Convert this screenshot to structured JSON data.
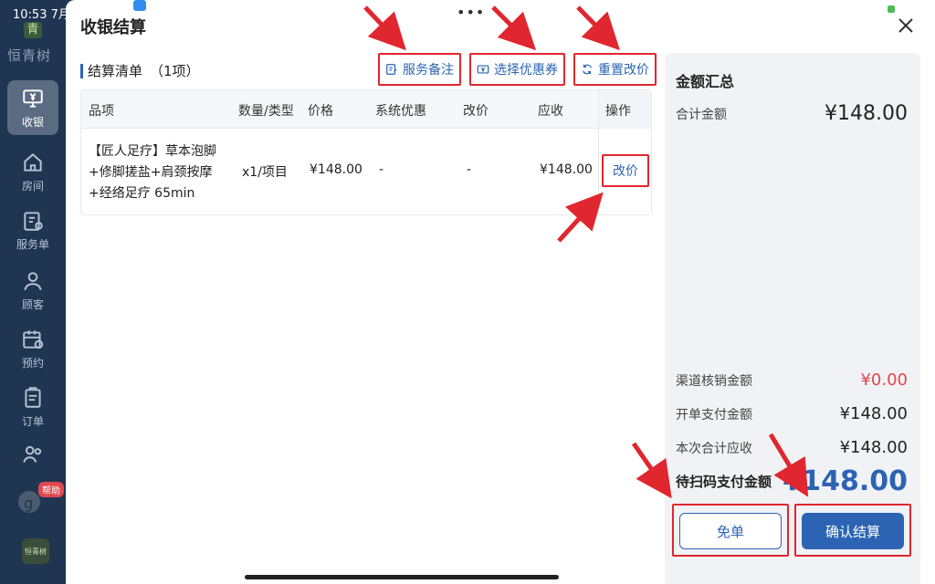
{
  "status": {
    "time": "10:53  7月"
  },
  "sidebar": {
    "logo_text": "恒青树",
    "items": [
      {
        "label": "收银",
        "icon": "cashier-icon",
        "active": true
      },
      {
        "label": "房间",
        "icon": "home-icon"
      },
      {
        "label": "服务单",
        "icon": "service-order-icon"
      },
      {
        "label": "顾客",
        "icon": "user-icon"
      },
      {
        "label": "预约",
        "icon": "calendar-icon"
      },
      {
        "label": "订单",
        "icon": "order-icon"
      }
    ],
    "help_badge": "帮助"
  },
  "dialog": {
    "title": "收银结算",
    "section_title": "结算清单",
    "section_count": "（1项）",
    "toolbar": {
      "remark": "服务备注",
      "coupon": "选择优惠券",
      "reset_price": "重置改价"
    },
    "table": {
      "headers": [
        "品项",
        "数量/类型",
        "价格",
        "系统优惠",
        "改价",
        "应收",
        "操作"
      ],
      "rows": [
        {
          "name_lines": [
            "【匠人足疗】草本泡脚",
            "+修脚搓盐+肩颈按摩",
            "+经络足疗 65min"
          ],
          "qty": "x1/项目",
          "price": "¥148.00",
          "discount": "-",
          "reprice": "-",
          "due": "¥148.00",
          "action": "改价"
        }
      ]
    }
  },
  "summary": {
    "title": "金额汇总",
    "total_label": "合计金额",
    "total_value": "¥148.00",
    "channel_label": "渠道核销金额",
    "channel_value": "¥0.00",
    "open_pay_label": "开单支付金额",
    "open_pay_value": "¥148.00",
    "this_due_label": "本次合计应收",
    "this_due_value": "¥148.00",
    "scan_label": "待扫码支付金额",
    "scan_value": "¥148.00",
    "free_button": "免单",
    "confirm_button": "确认结算"
  },
  "colors": {
    "accent": "#2c64b3",
    "highlight_box": "#e0262e",
    "sidebar_bg": "#1f3552",
    "red_value": "#e0484f"
  }
}
